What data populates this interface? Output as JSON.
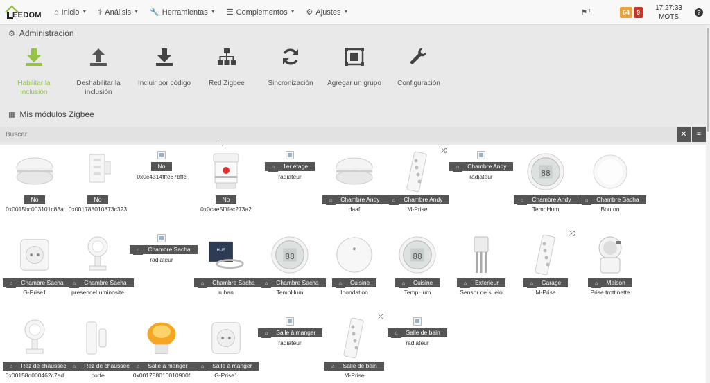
{
  "navbar": {
    "logo_text": "EEDOM",
    "menu": [
      {
        "label": "Inicio",
        "icon": "home-icon"
      },
      {
        "label": "Análisis",
        "icon": "stethoscope-icon"
      },
      {
        "label": "Herramientas",
        "icon": "wrench-icon"
      },
      {
        "label": "Complementos",
        "icon": "list-icon"
      },
      {
        "label": "Ajustes",
        "icon": "gear-icon"
      }
    ],
    "messages_count": "1",
    "badge_warning": "64",
    "badge_danger": "9",
    "time": "17:27:33",
    "mode": "MOTS",
    "help_icon": "question-circle-icon"
  },
  "admin": {
    "title": "Administración",
    "actions": [
      {
        "label": "Habilitar la inclusión",
        "icon": "download-icon"
      },
      {
        "label": "Deshabilitar la inclusión",
        "icon": "upload-icon"
      },
      {
        "label": "Incluir por código",
        "icon": "download-icon"
      },
      {
        "label": "Red Zigbee",
        "icon": "sitemap-icon"
      },
      {
        "label": "Sincronización",
        "icon": "sync-icon"
      },
      {
        "label": "Agregar un grupo",
        "icon": "object-group-icon"
      },
      {
        "label": "Configuración",
        "icon": "wrench-icon"
      }
    ],
    "active_color": "#94c348"
  },
  "modules": {
    "title": "Mis módulos Zigbee",
    "search_placeholder": "Buscar",
    "clear_icon": "times-icon",
    "collapse_icon": "equals-icon"
  },
  "devices": [
    {
      "object": "No",
      "name": "0x0015bc003101c83a",
      "image": "smoke-detector"
    },
    {
      "object": "No",
      "name": "0x001788010873c323",
      "image": "wall-switch"
    },
    {
      "object": "No",
      "name": "0x0c4314fffe67bffc",
      "image": "broken"
    },
    {
      "object": "No",
      "name": "0x0cae5ffffec273a2",
      "image": "siren"
    },
    {
      "object": "1er étage",
      "name": "radiateur",
      "image": "broken"
    },
    {
      "object": "Chambre Andy",
      "name": "daaf",
      "image": "smoke-detector"
    },
    {
      "object": "Chambre Andy",
      "name": "M-Prise",
      "image": "power-strip"
    },
    {
      "object": "Chambre Andy",
      "name": "radiateur",
      "image": "broken"
    },
    {
      "object": "Chambre Andy",
      "name": "TempHum",
      "image": "thermometer"
    },
    {
      "object": "Chambre Sacha",
      "name": "Bouton",
      "image": "button"
    },
    {
      "object": "Chambre Sacha",
      "name": "G-Prise1",
      "image": "smart-plug"
    },
    {
      "object": "Chambre Sacha",
      "name": "presenceLuminosite",
      "image": "motion-sensor"
    },
    {
      "object": "Chambre Sacha",
      "name": "radiateur",
      "image": "broken"
    },
    {
      "object": "Chambre Sacha",
      "name": "ruban",
      "image": "led-strip"
    },
    {
      "object": "Chambre Sacha",
      "name": "TempHum",
      "image": "thermometer"
    },
    {
      "object": "Cuisine",
      "name": "Inondation",
      "image": "water-sensor"
    },
    {
      "object": "Cuisine",
      "name": "TempHum",
      "image": "thermometer"
    },
    {
      "object": "Exterieur",
      "name": "Sensor de suelo",
      "image": "soil-sensor"
    },
    {
      "object": "Garage",
      "name": "M-Prise",
      "image": "power-strip"
    },
    {
      "object": "Maison",
      "name": "Prise trottinette",
      "image": "outdoor-plug"
    },
    {
      "object": "Rez de chaussée",
      "name": "0x00158d000462c7ad",
      "image": "motion-sensor"
    },
    {
      "object": "Rez de chaussée",
      "name": "porte",
      "image": "door-sensor"
    },
    {
      "object": "Salle à manger",
      "name": "0x001788010010900f",
      "image": "lamp"
    },
    {
      "object": "Salle à manger",
      "name": "G-Prise1",
      "image": "smart-plug"
    },
    {
      "object": "Salle à manger",
      "name": "radiateur",
      "image": "broken"
    },
    {
      "object": "Salle de bain",
      "name": "M-Prise",
      "image": "power-strip"
    },
    {
      "object": "Salle de bain",
      "name": "radiateur",
      "image": "broken"
    }
  ]
}
